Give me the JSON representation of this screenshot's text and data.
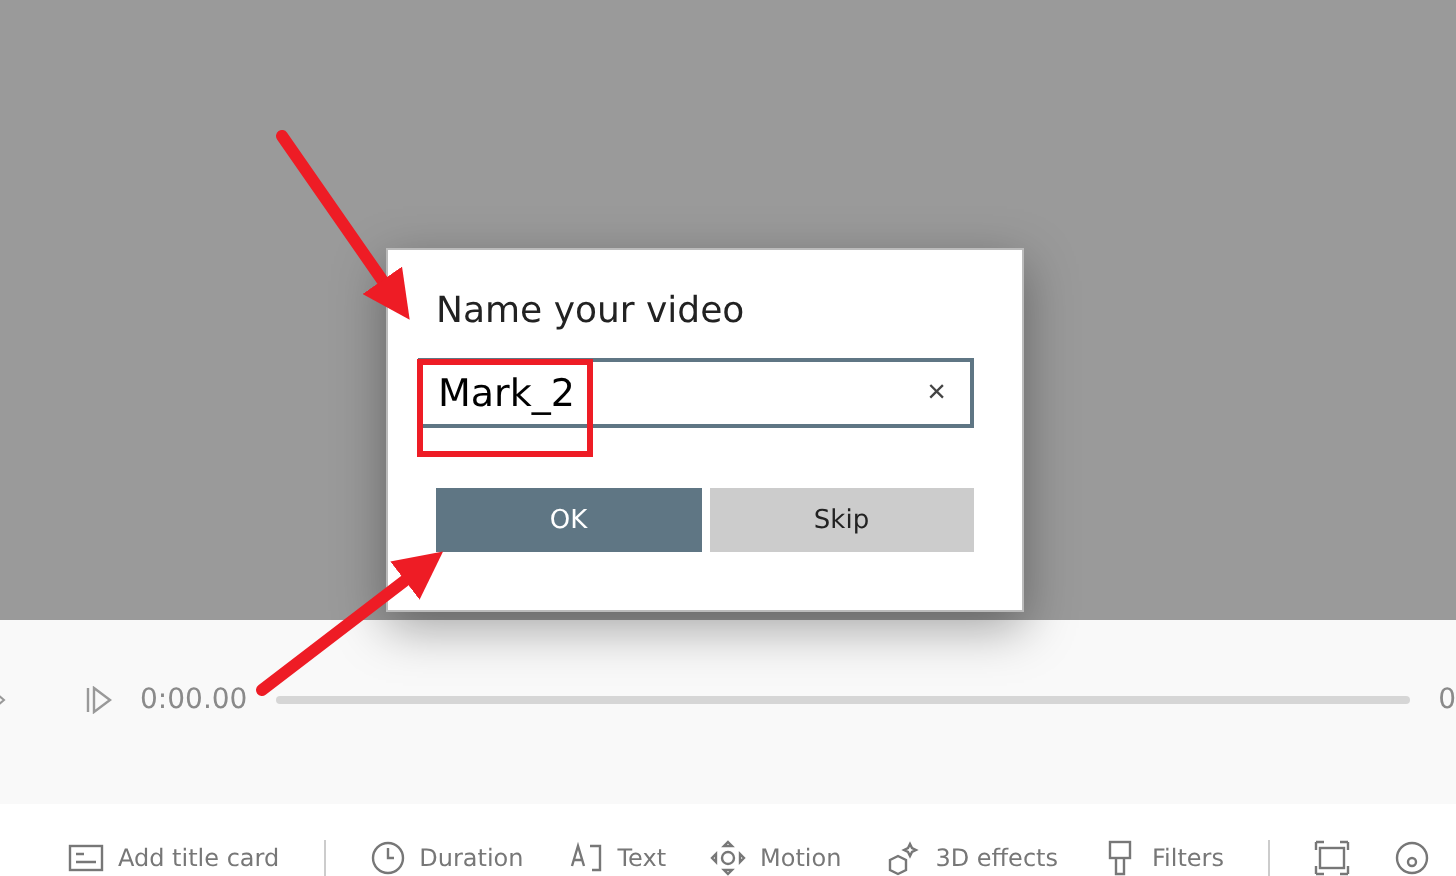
{
  "dialog": {
    "title": "Name your video",
    "field": {
      "value": "Mark_2",
      "clear": "×"
    },
    "buttons": [
      {
        "label": "OK",
        "kind": "primary"
      },
      {
        "label": "Skip",
        "kind": "secondary"
      }
    ]
  },
  "playback": {
    "current_time": "0:00.00",
    "end_time": "0"
  },
  "toolbar": {
    "items": [
      {
        "kind": "tool",
        "label": "Add title card"
      },
      {
        "kind": "divider"
      },
      {
        "kind": "tool",
        "label": "Duration"
      },
      {
        "kind": "tool",
        "label": "Text"
      },
      {
        "kind": "tool",
        "label": "Motion"
      },
      {
        "kind": "tool",
        "label": "3D effects"
      },
      {
        "kind": "tool",
        "label": "Filters"
      },
      {
        "kind": "divider"
      },
      {
        "kind": "icon_tool"
      },
      {
        "kind": "icon_tool"
      }
    ]
  }
}
